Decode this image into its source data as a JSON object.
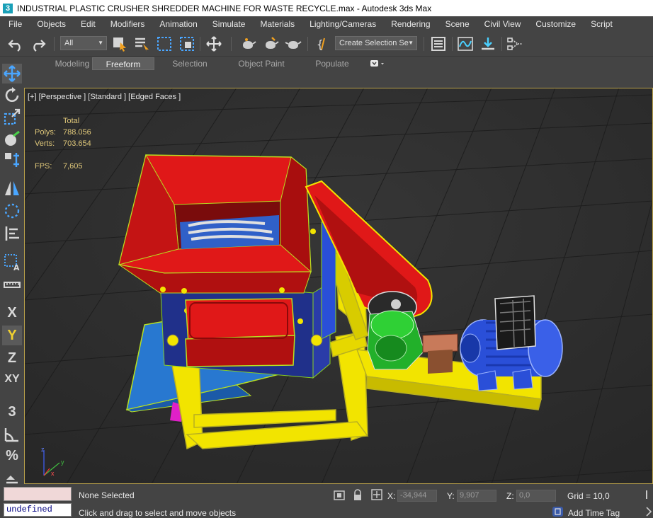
{
  "window": {
    "title": "INDUSTRIAL PLASTIC CRUSHER SHREDDER MACHINE FOR WASTE RECYCLE.max - Autodesk 3ds Max",
    "app_icon_glyph": "3"
  },
  "menu": {
    "items": [
      "File",
      "Objects",
      "Edit",
      "Modifiers",
      "Animation",
      "Simulate",
      "Materials",
      "Lighting/Cameras",
      "Rendering",
      "Scene",
      "Civil View",
      "Customize",
      "Script"
    ]
  },
  "toolbar": {
    "selection_filter": "All",
    "named_selection_set": "Create Selection Se",
    "icons": [
      "undo-icon",
      "redo-icon",
      "select-object-icon",
      "select-by-name-icon",
      "rectangular-selection-icon",
      "window-crossing-icon",
      "select-and-move-icon",
      "teapot-icon",
      "curve-editor-icon",
      "schematic-view-icon"
    ]
  },
  "ribbon": {
    "tabs": [
      "Modeling",
      "Freeform",
      "Selection",
      "Object Paint",
      "Populate"
    ],
    "active_tab": "Freeform"
  },
  "left_tools": {
    "labels": [
      "X",
      "Y",
      "Z",
      "XY",
      "3",
      "%"
    ]
  },
  "viewport": {
    "label": "[+] [Perspective ] [Standard ] [Edged Faces ]",
    "stats": {
      "header": "Total",
      "polys_label": "Polys:",
      "polys_value": "788.056",
      "verts_label": "Verts:",
      "verts_value": "703.654",
      "fps_label": "FPS:",
      "fps_value": "7,605"
    },
    "axis": {
      "x": "x",
      "y": "y",
      "z": "z"
    }
  },
  "status": {
    "maxscript_value": "undefined",
    "selection_status": "None Selected",
    "prompt": "Click and drag to select and move objects",
    "x_label": "X:",
    "x_value": "-34,944",
    "y_label": "Y:",
    "y_value": "9,907",
    "z_label": "Z:",
    "z_value": "0,0",
    "grid": "Grid = 10,0",
    "add_time_tag": "Add Time Tag"
  },
  "colors": {
    "ui_bg": "#444444",
    "viewport_bg": "#2e2e2e",
    "stats_text": "#e0c87a",
    "hopper_red": "#e01818",
    "frame_yellow": "#f2e400",
    "motor_blue": "#2a4fd8",
    "gearbox_green": "#22b02a",
    "chute_blue": "#2878d0"
  }
}
